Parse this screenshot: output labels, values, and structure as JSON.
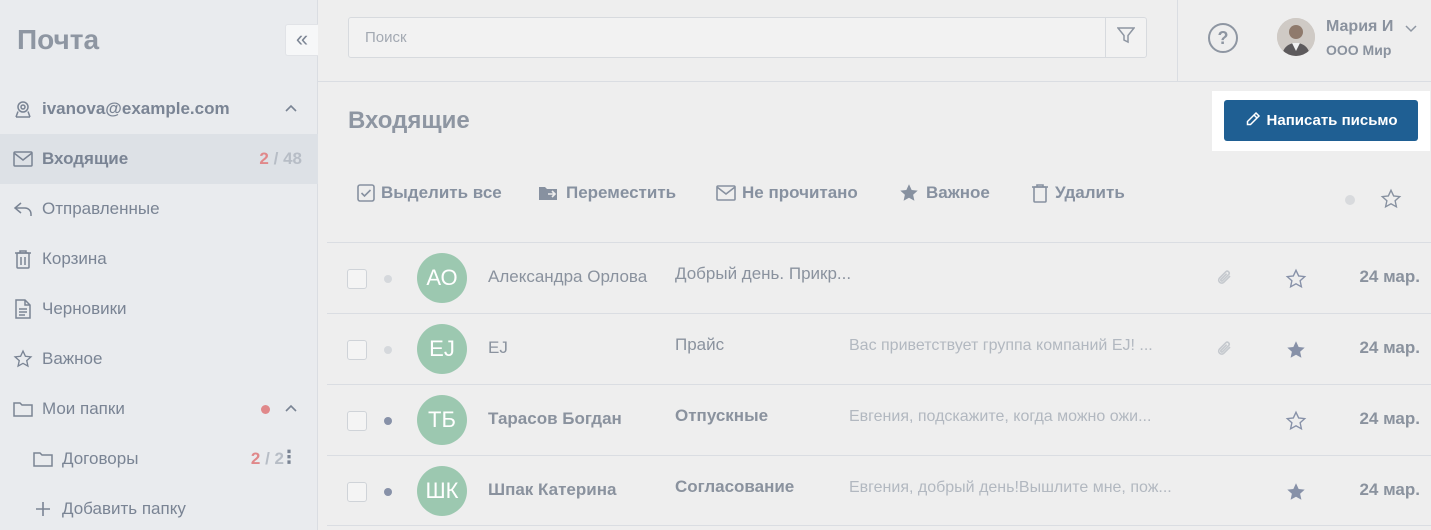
{
  "app": {
    "title": "Почта"
  },
  "sidebar": {
    "account": "ivanova@example.com",
    "items": [
      {
        "label": "Входящие",
        "unread": "2",
        "total": "48",
        "active": true
      },
      {
        "label": "Отправленные"
      },
      {
        "label": "Корзина"
      },
      {
        "label": "Черновики"
      },
      {
        "label": "Важное"
      }
    ],
    "my_folders": "Мои папки",
    "folders": [
      {
        "label": "Договоры",
        "unread": "2",
        "total": "2"
      }
    ],
    "add_folder": "Добавить папку",
    "separator": "/"
  },
  "search": {
    "placeholder": "Поиск"
  },
  "user": {
    "name": "Мария И",
    "org": "ООО Мир"
  },
  "help_icon_text": "?",
  "main": {
    "title": "Входящие",
    "compose_label": "Написать письмо",
    "toolbar": {
      "select_all": "Выделить все",
      "move": "Переместить",
      "unread": "Не прочитано",
      "important": "Важное",
      "delete": "Удалить"
    }
  },
  "emails": [
    {
      "initials": "АО",
      "sender": "Александра Орлова",
      "subject": "Добрый день. Прикр...",
      "preview": "",
      "attachment": true,
      "starred": false,
      "date": "24 мар.",
      "unread": false
    },
    {
      "initials": "EJ",
      "sender": "EJ",
      "subject": "Прайс",
      "preview": "Вас приветствует группа компаний EJ! ...",
      "attachment": true,
      "starred": true,
      "date": "24 мар.",
      "unread": false
    },
    {
      "initials": "ТБ",
      "sender": "Тарасов Богдан",
      "subject": "Отпускные",
      "preview": "Евгения, подскажите, когда можно ожи...",
      "attachment": false,
      "starred": false,
      "date": "24 мар.",
      "unread": true
    },
    {
      "initials": "ШК",
      "sender": "Шпак Катерина",
      "subject": "Согласование",
      "preview": "Евгения, добрый день!Вышлите мне, пож...",
      "attachment": false,
      "starred": true,
      "date": "24 мар.",
      "unread": true
    }
  ],
  "colors": {
    "accent": "#1f5f93",
    "avatar": "#9cc8b0",
    "counter_red": "#e0888a",
    "unread_dot": "#8791a8",
    "read_dot": "#d5d8dc",
    "star_filled": "#8791a8"
  }
}
